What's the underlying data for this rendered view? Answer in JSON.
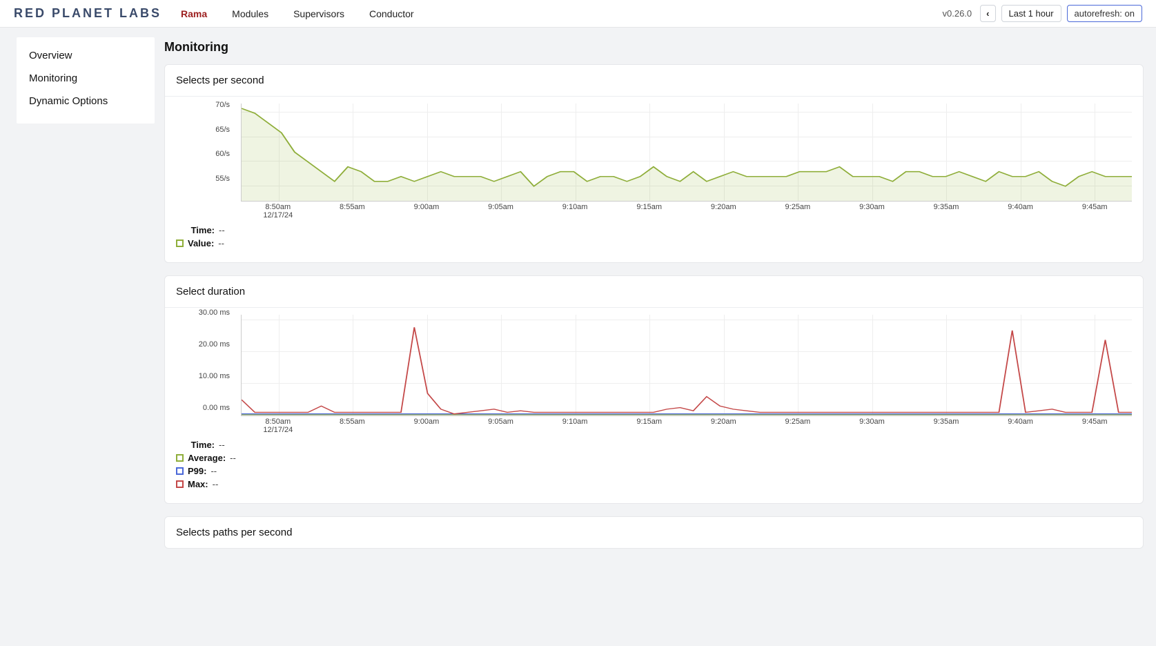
{
  "header": {
    "logo": "RED PLANET LABS",
    "nav": [
      {
        "label": "Rama",
        "active": true
      },
      {
        "label": "Modules"
      },
      {
        "label": "Supervisors"
      },
      {
        "label": "Conductor"
      }
    ],
    "version": "v0.26.0",
    "back_icon": "‹",
    "timerange": "Last 1 hour",
    "autorefresh": "autorefresh: on"
  },
  "sidebar": {
    "items": [
      {
        "label": "Overview"
      },
      {
        "label": "Monitoring"
      },
      {
        "label": "Dynamic Options"
      }
    ]
  },
  "page": {
    "title": "Monitoring"
  },
  "panels": {
    "p1": {
      "title": "Selects per second",
      "legend": {
        "time_label": "Time:",
        "time_val": "--",
        "value_label": "Value:",
        "value_val": "--"
      }
    },
    "p2": {
      "title": "Select duration",
      "legend": {
        "time_label": "Time:",
        "time_val": "--",
        "avg_label": "Average:",
        "avg_val": "--",
        "p99_label": "P99:",
        "p99_val": "--",
        "max_label": "Max:",
        "max_val": "--"
      }
    },
    "p3": {
      "title": "Selects paths per second"
    }
  },
  "chart_data": [
    {
      "id": "selects_per_second",
      "type": "area",
      "title": "Selects per second",
      "xlabel": "",
      "ylabel": "",
      "ylim": [
        52,
        72
      ],
      "y_ticks": [
        "55/s",
        "60/s",
        "65/s",
        "70/s"
      ],
      "x_ticks": [
        {
          "label": "8:50am",
          "sub": "12/17/24"
        },
        {
          "label": "8:55am"
        },
        {
          "label": "9:00am"
        },
        {
          "label": "9:05am"
        },
        {
          "label": "9:10am"
        },
        {
          "label": "9:15am"
        },
        {
          "label": "9:20am"
        },
        {
          "label": "9:25am"
        },
        {
          "label": "9:30am"
        },
        {
          "label": "9:35am"
        },
        {
          "label": "9:40am"
        },
        {
          "label": "9:45am"
        }
      ],
      "series": [
        {
          "name": "Value",
          "color": "#8fae3a",
          "values": [
            71,
            70,
            68,
            66,
            62,
            60,
            58,
            56,
            59,
            58,
            56,
            56,
            57,
            56,
            57,
            58,
            57,
            57,
            57,
            56,
            57,
            58,
            55,
            57,
            58,
            58,
            56,
            57,
            57,
            56,
            57,
            59,
            57,
            56,
            58,
            56,
            57,
            58,
            57,
            57,
            57,
            57,
            58,
            58,
            58,
            59,
            57,
            57,
            57,
            56,
            58,
            58,
            57,
            57,
            58,
            57,
            56,
            58,
            57,
            57,
            58,
            56,
            55,
            57,
            58,
            57,
            57,
            57
          ]
        }
      ]
    },
    {
      "id": "select_duration",
      "type": "line",
      "title": "Select duration",
      "xlabel": "",
      "ylabel": "",
      "ylim": [
        0,
        32
      ],
      "y_ticks": [
        "0.00 ms",
        "10.00 ms",
        "20.00 ms",
        "30.00 ms"
      ],
      "x_ticks": [
        {
          "label": "8:50am",
          "sub": "12/17/24"
        },
        {
          "label": "8:55am"
        },
        {
          "label": "9:00am"
        },
        {
          "label": "9:05am"
        },
        {
          "label": "9:10am"
        },
        {
          "label": "9:15am"
        },
        {
          "label": "9:20am"
        },
        {
          "label": "9:25am"
        },
        {
          "label": "9:30am"
        },
        {
          "label": "9:35am"
        },
        {
          "label": "9:40am"
        },
        {
          "label": "9:45am"
        }
      ],
      "series": [
        {
          "name": "Average",
          "color": "#8fae3a",
          "values": [
            0.3,
            0.3,
            0.3,
            0.3,
            0.3,
            0.3,
            0.3,
            0.3,
            0.3,
            0.3,
            0.3,
            0.3,
            0.3,
            0.3,
            0.3,
            0.3,
            0.3,
            0.3,
            0.3,
            0.3,
            0.3,
            0.3,
            0.3,
            0.3,
            0.3,
            0.3,
            0.3,
            0.3,
            0.3,
            0.3,
            0.3,
            0.3,
            0.3,
            0.3,
            0.3,
            0.3,
            0.3,
            0.3,
            0.3,
            0.3,
            0.3,
            0.3,
            0.3,
            0.3,
            0.3,
            0.3,
            0.3,
            0.3,
            0.3,
            0.3,
            0.3,
            0.3,
            0.3,
            0.3,
            0.3,
            0.3,
            0.3,
            0.3,
            0.3,
            0.3,
            0.3,
            0.3,
            0.3,
            0.3,
            0.3,
            0.3,
            0.3,
            0.3
          ]
        },
        {
          "name": "P99",
          "color": "#4a68d8",
          "values": [
            0.5,
            0.5,
            0.5,
            0.5,
            0.5,
            0.5,
            0.5,
            0.5,
            0.5,
            0.5,
            0.5,
            0.5,
            0.5,
            0.5,
            0.5,
            0.5,
            0.5,
            0.5,
            0.5,
            0.5,
            0.5,
            0.5,
            0.5,
            0.5,
            0.5,
            0.5,
            0.5,
            0.5,
            0.5,
            0.5,
            0.5,
            0.5,
            0.5,
            0.5,
            0.5,
            0.5,
            0.5,
            0.5,
            0.5,
            0.5,
            0.5,
            0.5,
            0.5,
            0.5,
            0.5,
            0.5,
            0.5,
            0.5,
            0.5,
            0.5,
            0.5,
            0.5,
            0.5,
            0.5,
            0.5,
            0.5,
            0.5,
            0.5,
            0.5,
            0.5,
            0.5,
            0.5,
            0.5,
            0.5,
            0.5,
            0.5,
            0.5,
            0.5
          ]
        },
        {
          "name": "Max",
          "color": "#c44848",
          "values": [
            5,
            1,
            1,
            1,
            1,
            1,
            3,
            1,
            1,
            1,
            1,
            1,
            1,
            28,
            7,
            2,
            0.5,
            1,
            1.5,
            2,
            1,
            1.5,
            1,
            1,
            1,
            1,
            1,
            1,
            1,
            1,
            1,
            1,
            2,
            2.5,
            1.5,
            6,
            3,
            2,
            1.5,
            1,
            1,
            1,
            1,
            1,
            1,
            1,
            1,
            1,
            1,
            1,
            1,
            1,
            1,
            1,
            1,
            1,
            1,
            1,
            27,
            1,
            1.5,
            2,
            1,
            1,
            1,
            24,
            1,
            1
          ]
        }
      ]
    }
  ]
}
